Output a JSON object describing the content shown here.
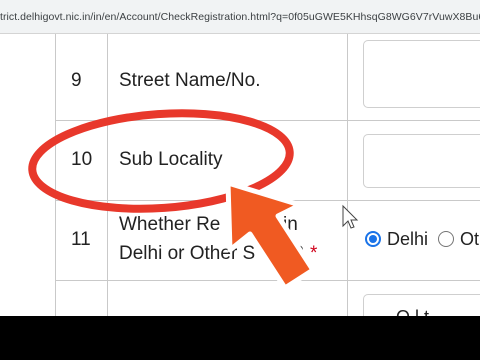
{
  "browser": {
    "url": "trict.delhigovt.nic.in/in/en/Account/CheckRegistration.html?q=0f05uGWE5KHhsqG8WG6V7rVuwX8Bu6PF6"
  },
  "form": {
    "rows": [
      {
        "number": "9",
        "label": "Street Name/No."
      },
      {
        "number": "10",
        "label": "Sub Locality"
      },
      {
        "number": "11",
        "label_line1": "Whether Re",
        "label_line1_tail": "in",
        "label_line2": "Delhi or Other S",
        "label_line2_tail": "?",
        "required_mark": "*"
      }
    ],
    "residence_options": [
      {
        "label": "Delhi",
        "selected": true
      },
      {
        "label": "Ot",
        "selected": false
      }
    ],
    "partial_text_bottom": "O  l  t"
  },
  "annotation": {
    "highlight_color": "#e8382b",
    "arrow_fill": "#f05a22",
    "arrow_outline": "#ffffff",
    "highlight_target": "Sub Locality"
  }
}
